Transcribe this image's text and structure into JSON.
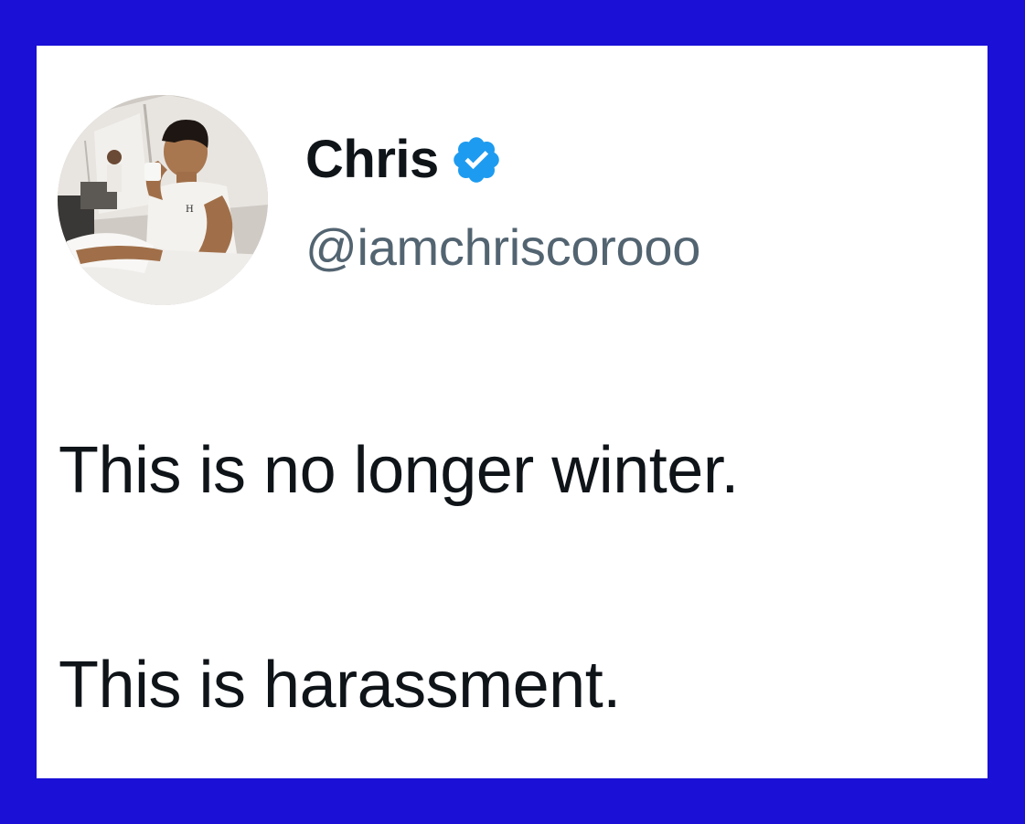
{
  "post": {
    "author": {
      "display_name": "Chris",
      "handle": "@iamchriscorooo",
      "verified": true,
      "verified_icon": "verified-badge-icon",
      "avatar": "profile-photo"
    },
    "text_lines": [
      "This is no longer winter.",
      "This is harassment."
    ]
  },
  "colors": {
    "frame_background": "#1a10d6",
    "card_background": "#ffffff",
    "text_primary": "#0f1419",
    "text_secondary": "#536471",
    "verified_badge": "#1d9bf0"
  }
}
